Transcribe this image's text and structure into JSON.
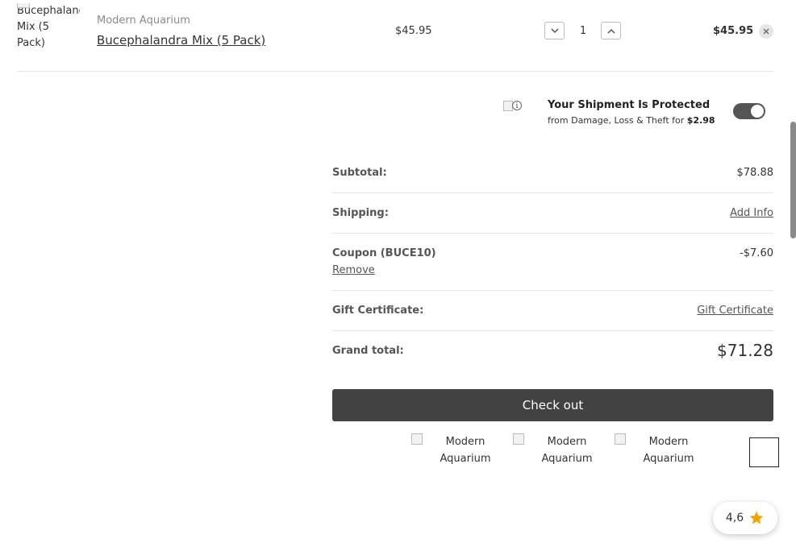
{
  "product": {
    "image_alt": "Bucephalandra Mix (5 Pack)",
    "brand": "Modern Aquarium",
    "name": "Bucephalandra Mix (5 Pack)",
    "price": "$45.95",
    "quantity": "1",
    "line_total": "$45.95"
  },
  "protection": {
    "title": "Your Shipment Is Protected",
    "subtitle": "from Damage, Loss & Theft for",
    "fee": "$2.98",
    "enabled": true
  },
  "totals": {
    "subtotal_label": "Subtotal:",
    "subtotal_value": "$78.88",
    "shipping_label": "Shipping:",
    "shipping_link": "Add Info",
    "coupon_label": "Coupon (BUCE10)",
    "coupon_value": "-$7.60",
    "coupon_remove": "Remove",
    "gift_label": "Gift Certificate:",
    "gift_link": "Gift Certificate",
    "grand_label": "Grand total:",
    "grand_value": "$71.28"
  },
  "checkout_label": "Check out",
  "payment_logos": [
    "Modern Aquarium",
    "Modern Aquarium",
    "Modern Aquarium"
  ],
  "rating": {
    "value": "4,6",
    "star_color": "#f0a500"
  },
  "colors": {
    "button_dark": "#424242",
    "toggle_on": "#555555"
  }
}
